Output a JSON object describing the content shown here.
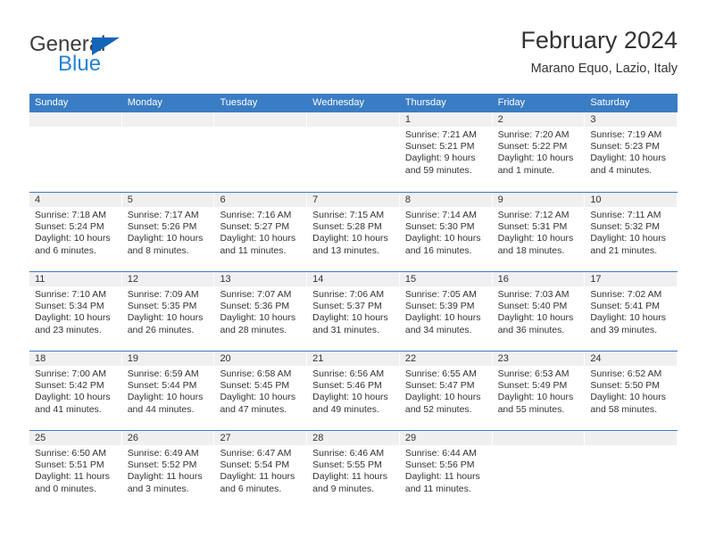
{
  "brand": {
    "name_part1": "General",
    "name_part2": "Blue",
    "accent_color": "#2383d4",
    "triangle_color": "#1565b8"
  },
  "header": {
    "title": "February 2024",
    "subtitle": "Marano Equo, Lazio, Italy"
  },
  "theme": {
    "header_bar_color": "#3b7dc4",
    "day_strip_color": "#f0f0f0",
    "text_color": "#333333"
  },
  "weekdays": [
    "Sunday",
    "Monday",
    "Tuesday",
    "Wednesday",
    "Thursday",
    "Friday",
    "Saturday"
  ],
  "weeks": [
    [
      {
        "empty": true
      },
      {
        "empty": true
      },
      {
        "empty": true
      },
      {
        "empty": true
      },
      {
        "date": "1",
        "sunrise": "Sunrise: 7:21 AM",
        "sunset": "Sunset: 5:21 PM",
        "daylight": "Daylight: 9 hours and 59 minutes."
      },
      {
        "date": "2",
        "sunrise": "Sunrise: 7:20 AM",
        "sunset": "Sunset: 5:22 PM",
        "daylight": "Daylight: 10 hours and 1 minute."
      },
      {
        "date": "3",
        "sunrise": "Sunrise: 7:19 AM",
        "sunset": "Sunset: 5:23 PM",
        "daylight": "Daylight: 10 hours and 4 minutes."
      }
    ],
    [
      {
        "date": "4",
        "sunrise": "Sunrise: 7:18 AM",
        "sunset": "Sunset: 5:24 PM",
        "daylight": "Daylight: 10 hours and 6 minutes."
      },
      {
        "date": "5",
        "sunrise": "Sunrise: 7:17 AM",
        "sunset": "Sunset: 5:26 PM",
        "daylight": "Daylight: 10 hours and 8 minutes."
      },
      {
        "date": "6",
        "sunrise": "Sunrise: 7:16 AM",
        "sunset": "Sunset: 5:27 PM",
        "daylight": "Daylight: 10 hours and 11 minutes."
      },
      {
        "date": "7",
        "sunrise": "Sunrise: 7:15 AM",
        "sunset": "Sunset: 5:28 PM",
        "daylight": "Daylight: 10 hours and 13 minutes."
      },
      {
        "date": "8",
        "sunrise": "Sunrise: 7:14 AM",
        "sunset": "Sunset: 5:30 PM",
        "daylight": "Daylight: 10 hours and 16 minutes."
      },
      {
        "date": "9",
        "sunrise": "Sunrise: 7:12 AM",
        "sunset": "Sunset: 5:31 PM",
        "daylight": "Daylight: 10 hours and 18 minutes."
      },
      {
        "date": "10",
        "sunrise": "Sunrise: 7:11 AM",
        "sunset": "Sunset: 5:32 PM",
        "daylight": "Daylight: 10 hours and 21 minutes."
      }
    ],
    [
      {
        "date": "11",
        "sunrise": "Sunrise: 7:10 AM",
        "sunset": "Sunset: 5:34 PM",
        "daylight": "Daylight: 10 hours and 23 minutes."
      },
      {
        "date": "12",
        "sunrise": "Sunrise: 7:09 AM",
        "sunset": "Sunset: 5:35 PM",
        "daylight": "Daylight: 10 hours and 26 minutes."
      },
      {
        "date": "13",
        "sunrise": "Sunrise: 7:07 AM",
        "sunset": "Sunset: 5:36 PM",
        "daylight": "Daylight: 10 hours and 28 minutes."
      },
      {
        "date": "14",
        "sunrise": "Sunrise: 7:06 AM",
        "sunset": "Sunset: 5:37 PM",
        "daylight": "Daylight: 10 hours and 31 minutes."
      },
      {
        "date": "15",
        "sunrise": "Sunrise: 7:05 AM",
        "sunset": "Sunset: 5:39 PM",
        "daylight": "Daylight: 10 hours and 34 minutes."
      },
      {
        "date": "16",
        "sunrise": "Sunrise: 7:03 AM",
        "sunset": "Sunset: 5:40 PM",
        "daylight": "Daylight: 10 hours and 36 minutes."
      },
      {
        "date": "17",
        "sunrise": "Sunrise: 7:02 AM",
        "sunset": "Sunset: 5:41 PM",
        "daylight": "Daylight: 10 hours and 39 minutes."
      }
    ],
    [
      {
        "date": "18",
        "sunrise": "Sunrise: 7:00 AM",
        "sunset": "Sunset: 5:42 PM",
        "daylight": "Daylight: 10 hours and 41 minutes."
      },
      {
        "date": "19",
        "sunrise": "Sunrise: 6:59 AM",
        "sunset": "Sunset: 5:44 PM",
        "daylight": "Daylight: 10 hours and 44 minutes."
      },
      {
        "date": "20",
        "sunrise": "Sunrise: 6:58 AM",
        "sunset": "Sunset: 5:45 PM",
        "daylight": "Daylight: 10 hours and 47 minutes."
      },
      {
        "date": "21",
        "sunrise": "Sunrise: 6:56 AM",
        "sunset": "Sunset: 5:46 PM",
        "daylight": "Daylight: 10 hours and 49 minutes."
      },
      {
        "date": "22",
        "sunrise": "Sunrise: 6:55 AM",
        "sunset": "Sunset: 5:47 PM",
        "daylight": "Daylight: 10 hours and 52 minutes."
      },
      {
        "date": "23",
        "sunrise": "Sunrise: 6:53 AM",
        "sunset": "Sunset: 5:49 PM",
        "daylight": "Daylight: 10 hours and 55 minutes."
      },
      {
        "date": "24",
        "sunrise": "Sunrise: 6:52 AM",
        "sunset": "Sunset: 5:50 PM",
        "daylight": "Daylight: 10 hours and 58 minutes."
      }
    ],
    [
      {
        "date": "25",
        "sunrise": "Sunrise: 6:50 AM",
        "sunset": "Sunset: 5:51 PM",
        "daylight": "Daylight: 11 hours and 0 minutes."
      },
      {
        "date": "26",
        "sunrise": "Sunrise: 6:49 AM",
        "sunset": "Sunset: 5:52 PM",
        "daylight": "Daylight: 11 hours and 3 minutes."
      },
      {
        "date": "27",
        "sunrise": "Sunrise: 6:47 AM",
        "sunset": "Sunset: 5:54 PM",
        "daylight": "Daylight: 11 hours and 6 minutes."
      },
      {
        "date": "28",
        "sunrise": "Sunrise: 6:46 AM",
        "sunset": "Sunset: 5:55 PM",
        "daylight": "Daylight: 11 hours and 9 minutes."
      },
      {
        "date": "29",
        "sunrise": "Sunrise: 6:44 AM",
        "sunset": "Sunset: 5:56 PM",
        "daylight": "Daylight: 11 hours and 11 minutes."
      },
      {
        "empty": true
      },
      {
        "empty": true
      }
    ]
  ]
}
